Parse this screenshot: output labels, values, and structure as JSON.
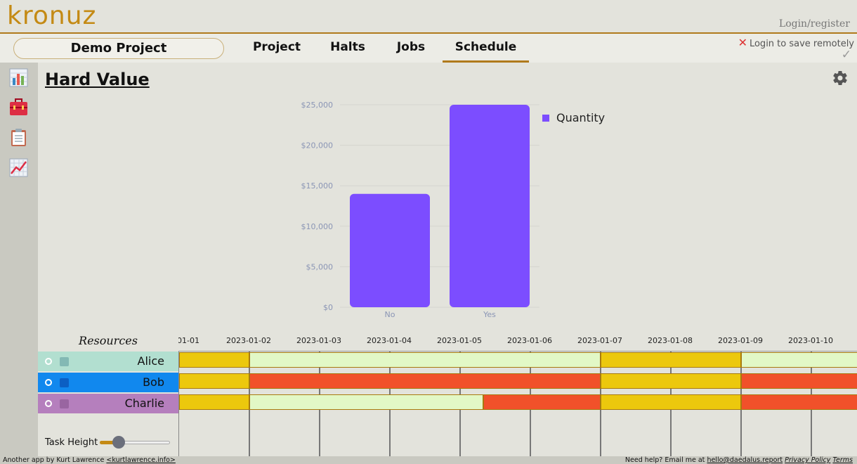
{
  "app": {
    "logo": "kronuz",
    "login": "Login/register"
  },
  "nav": {
    "project_name": "Demo Project",
    "tabs": [
      {
        "label": "Project",
        "active": false
      },
      {
        "label": "Halts",
        "active": false
      },
      {
        "label": "Jobs",
        "active": false
      },
      {
        "label": "Schedule",
        "active": true
      }
    ],
    "save_status": "Login to save remotely",
    "close_icon": "close-icon",
    "check_icon": "checkmark-icon"
  },
  "sidebar": {
    "items": [
      {
        "icon": "bar-chart-icon"
      },
      {
        "icon": "toolbox-icon"
      },
      {
        "icon": "clipboard-icon"
      },
      {
        "icon": "line-chart-icon"
      }
    ]
  },
  "main": {
    "title": "Hard Value",
    "settings_icon": "gear-icon"
  },
  "chart_data": {
    "type": "bar",
    "categories": [
      "No",
      "Yes"
    ],
    "series": [
      {
        "name": "Quantity",
        "values": [
          14000,
          25000
        ],
        "color": "#7c4dff"
      }
    ],
    "yticks": [
      "$0",
      "$5,000",
      "$10,000",
      "$15,000",
      "$20,000",
      "$25,000"
    ],
    "ylim": [
      0,
      25000
    ],
    "grid": true,
    "legend": "right"
  },
  "gantt": {
    "resources_label": "Resources",
    "dates": [
      "01-01",
      "2023-01-02",
      "2023-01-03",
      "2023-01-04",
      "2023-01-05",
      "2023-01-06",
      "2023-01-07",
      "2023-01-08",
      "2023-01-09",
      "2023-01-10"
    ],
    "colors": {
      "halt": "#ecc80d",
      "free": "#e2f8c6",
      "busy": "#f1512a"
    },
    "resources": [
      {
        "name": "Alice",
        "color": "#b2dfd0",
        "mini": "#6fa8a8",
        "tasks": [
          {
            "start": 0,
            "end": 1,
            "kind": "halt"
          },
          {
            "start": 1,
            "end": 6,
            "kind": "free"
          },
          {
            "start": 6,
            "end": 8,
            "kind": "halt"
          },
          {
            "start": 8,
            "end": 9.7,
            "kind": "free"
          }
        ]
      },
      {
        "name": "Bob",
        "color": "#1188ee",
        "mini": "#0a4fb0",
        "tasks": [
          {
            "start": 0,
            "end": 1,
            "kind": "halt"
          },
          {
            "start": 1,
            "end": 6,
            "kind": "busy"
          },
          {
            "start": 6,
            "end": 8,
            "kind": "halt"
          },
          {
            "start": 8,
            "end": 9.7,
            "kind": "busy"
          }
        ]
      },
      {
        "name": "Charlie",
        "color": "#b57fbd",
        "mini": "#8d5a96",
        "tasks": [
          {
            "start": 0,
            "end": 1,
            "kind": "halt"
          },
          {
            "start": 1,
            "end": 4.33,
            "kind": "free"
          },
          {
            "start": 4.33,
            "end": 6,
            "kind": "busy"
          },
          {
            "start": 6,
            "end": 8,
            "kind": "halt"
          },
          {
            "start": 8,
            "end": 9.7,
            "kind": "busy"
          }
        ]
      }
    ],
    "task_height_label": "Task Height",
    "task_height_value": 0.27
  },
  "footer": {
    "credit_prefix": "Another app by Kurt Lawrence",
    "credit_link": "<kurtlawrence.info>",
    "help_prefix": "Need help? Email me at",
    "help_email": "hello@daedalus.report",
    "privacy": "Privacy Policy",
    "terms": "Terms"
  }
}
